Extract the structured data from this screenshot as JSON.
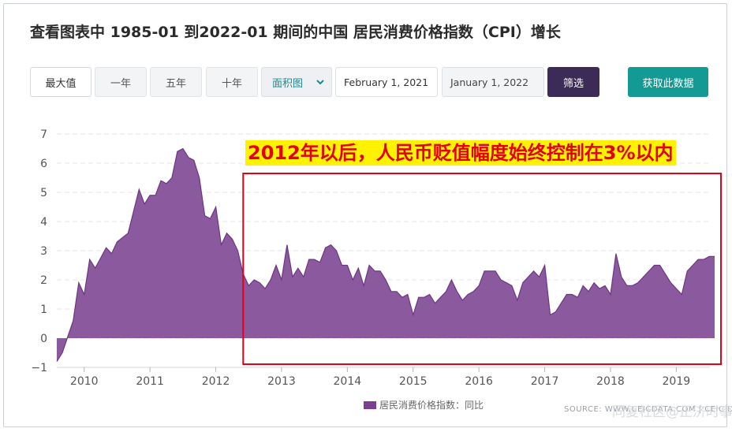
{
  "page": {
    "title": "查看图表中 1985-01 到2022-01 期间的中国 居民消费价格指数（CPI）增长"
  },
  "toolbar": {
    "buttons": [
      {
        "label": "最大值",
        "active": true
      },
      {
        "label": "一年",
        "active": false
      },
      {
        "label": "五年",
        "active": false
      },
      {
        "label": "十年",
        "active": false
      }
    ],
    "chart_type_select": "面积图",
    "start_date": "February 1, 2021",
    "end_date": "January 1, 2022",
    "filter_label": "筛选",
    "fetch_label": "获取此数据"
  },
  "annotation": {
    "text": "2012年以后，人民币贬值幅度始终控制在3%以内"
  },
  "legend": {
    "label": "居民消费价格指数：同比"
  },
  "source": {
    "text": "SOURCE: WWW.CEICDATA.COM | CEIC Data"
  },
  "watermark": {
    "text": "同复社区@正济时事"
  },
  "colors": {
    "area_fill": "#8b5a9e",
    "area_stroke": "#6e3582",
    "filter_button": "#3d2b57",
    "fetch_button": "#139a94",
    "highlight_box": "#e3001b",
    "annotation_bg": "#fff200"
  },
  "chart_data": {
    "type": "area",
    "series": [
      {
        "name": "居民消费价格指数：同比",
        "points": [
          [
            "2009-08",
            -0.8
          ],
          [
            "2009-09",
            -0.5
          ],
          [
            "2009-11",
            0.6
          ],
          [
            "2009-12",
            1.9
          ],
          [
            "2010-01",
            1.5
          ],
          [
            "2010-02",
            2.7
          ],
          [
            "2010-03",
            2.4
          ],
          [
            "2010-05",
            3.1
          ],
          [
            "2010-06",
            2.9
          ],
          [
            "2010-07",
            3.3
          ],
          [
            "2010-09",
            3.6
          ],
          [
            "2010-11",
            5.1
          ],
          [
            "2010-12",
            4.6
          ],
          [
            "2011-01",
            4.9
          ],
          [
            "2011-02",
            4.9
          ],
          [
            "2011-03",
            5.4
          ],
          [
            "2011-04",
            5.3
          ],
          [
            "2011-05",
            5.5
          ],
          [
            "2011-06",
            6.4
          ],
          [
            "2011-07",
            6.5
          ],
          [
            "2011-08",
            6.2
          ],
          [
            "2011-09",
            6.1
          ],
          [
            "2011-10",
            5.5
          ],
          [
            "2011-11",
            4.2
          ],
          [
            "2011-12",
            4.1
          ],
          [
            "2012-01",
            4.5
          ],
          [
            "2012-02",
            3.2
          ],
          [
            "2012-03",
            3.6
          ],
          [
            "2012-04",
            3.4
          ],
          [
            "2012-05",
            3.0
          ],
          [
            "2012-06",
            2.2
          ],
          [
            "2012-07",
            1.8
          ],
          [
            "2012-08",
            2.0
          ],
          [
            "2012-09",
            1.9
          ],
          [
            "2012-10",
            1.7
          ],
          [
            "2012-11",
            2.0
          ],
          [
            "2012-12",
            2.5
          ],
          [
            "2013-01",
            2.0
          ],
          [
            "2013-02",
            3.2
          ],
          [
            "2013-03",
            2.1
          ],
          [
            "2013-04",
            2.4
          ],
          [
            "2013-05",
            2.1
          ],
          [
            "2013-06",
            2.7
          ],
          [
            "2013-07",
            2.7
          ],
          [
            "2013-08",
            2.6
          ],
          [
            "2013-09",
            3.1
          ],
          [
            "2013-10",
            3.2
          ],
          [
            "2013-11",
            3.0
          ],
          [
            "2013-12",
            2.5
          ],
          [
            "2014-01",
            2.5
          ],
          [
            "2014-02",
            2.0
          ],
          [
            "2014-03",
            2.4
          ],
          [
            "2014-04",
            1.8
          ],
          [
            "2014-05",
            2.5
          ],
          [
            "2014-06",
            2.3
          ],
          [
            "2014-07",
            2.3
          ],
          [
            "2014-08",
            2.0
          ],
          [
            "2014-09",
            1.6
          ],
          [
            "2014-10",
            1.6
          ],
          [
            "2014-11",
            1.4
          ],
          [
            "2014-12",
            1.5
          ],
          [
            "2015-01",
            0.8
          ],
          [
            "2015-02",
            1.4
          ],
          [
            "2015-03",
            1.4
          ],
          [
            "2015-04",
            1.5
          ],
          [
            "2015-05",
            1.2
          ],
          [
            "2015-06",
            1.4
          ],
          [
            "2015-07",
            1.6
          ],
          [
            "2015-08",
            2.0
          ],
          [
            "2015-09",
            1.6
          ],
          [
            "2015-10",
            1.3
          ],
          [
            "2015-11",
            1.5
          ],
          [
            "2015-12",
            1.6
          ],
          [
            "2016-01",
            1.8
          ],
          [
            "2016-02",
            2.3
          ],
          [
            "2016-03",
            2.3
          ],
          [
            "2016-04",
            2.3
          ],
          [
            "2016-05",
            2.0
          ],
          [
            "2016-06",
            1.9
          ],
          [
            "2016-07",
            1.8
          ],
          [
            "2016-08",
            1.3
          ],
          [
            "2016-09",
            1.9
          ],
          [
            "2016-10",
            2.1
          ],
          [
            "2016-11",
            2.3
          ],
          [
            "2016-12",
            2.1
          ],
          [
            "2017-01",
            2.5
          ],
          [
            "2017-02",
            0.8
          ],
          [
            "2017-03",
            0.9
          ],
          [
            "2017-04",
            1.2
          ],
          [
            "2017-05",
            1.5
          ],
          [
            "2017-06",
            1.5
          ],
          [
            "2017-07",
            1.4
          ],
          [
            "2017-08",
            1.8
          ],
          [
            "2017-09",
            1.6
          ],
          [
            "2017-10",
            1.9
          ],
          [
            "2017-11",
            1.7
          ],
          [
            "2017-12",
            1.8
          ],
          [
            "2018-01",
            1.5
          ],
          [
            "2018-02",
            2.9
          ],
          [
            "2018-03",
            2.1
          ],
          [
            "2018-04",
            1.8
          ],
          [
            "2018-05",
            1.8
          ],
          [
            "2018-06",
            1.9
          ],
          [
            "2018-07",
            2.1
          ],
          [
            "2018-08",
            2.3
          ],
          [
            "2018-09",
            2.5
          ],
          [
            "2018-10",
            2.5
          ],
          [
            "2018-11",
            2.2
          ],
          [
            "2018-12",
            1.9
          ],
          [
            "2019-01",
            1.7
          ],
          [
            "2019-02",
            1.5
          ],
          [
            "2019-03",
            2.3
          ],
          [
            "2019-04",
            2.5
          ],
          [
            "2019-05",
            2.7
          ],
          [
            "2019-06",
            2.7
          ],
          [
            "2019-07",
            2.8
          ],
          [
            "2019-08",
            2.8
          ]
        ]
      }
    ],
    "y_ticks": [
      "7",
      "6",
      "5",
      "4",
      "3",
      "2",
      "1",
      "0",
      "−1"
    ],
    "x_ticks": [
      "2010",
      "2011",
      "2012",
      "2013",
      "2014",
      "2015",
      "2016",
      "2017",
      "2018",
      "2019"
    ],
    "xlim": [
      "2009-08",
      "2019-08"
    ],
    "ylim": [
      -1,
      7
    ],
    "grid": true,
    "highlight_range": [
      "2012-06",
      "2019-08"
    ],
    "legend_position": "bottom"
  }
}
